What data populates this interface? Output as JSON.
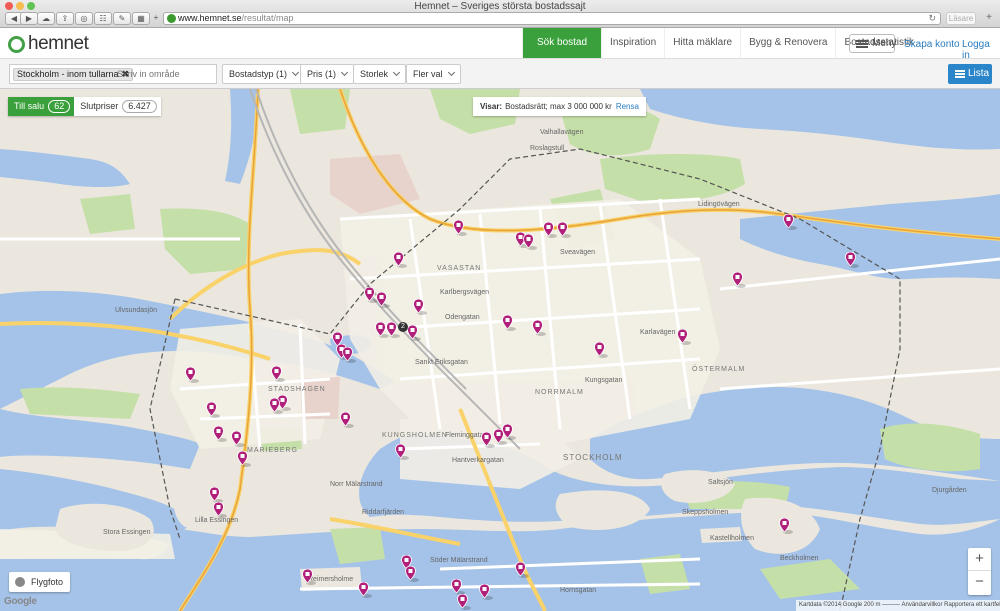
{
  "browser": {
    "window_title": "Hemnet – Sveriges största bostadssajt",
    "url_host": "www.hemnet.se",
    "url_path": "/resultat/map",
    "reader_label": "Läsare"
  },
  "header": {
    "logo_text": "hemnet",
    "nav": [
      "Sök bostad",
      "Inspiration",
      "Hitta mäklare",
      "Bygg & Renovera",
      "Bostadsstatistik"
    ],
    "menu_label": "Meny",
    "create_account": "Skapa konto",
    "login": "Logga in"
  },
  "filters": {
    "location_chip": "Stockholm - inom tullarna",
    "search_placeholder": "Skriv in område",
    "dropdowns": [
      "Bostadstyp (1)",
      "Pris (1)",
      "Storlek",
      "Fler val"
    ],
    "list_button": "Lista"
  },
  "map": {
    "tabs": [
      {
        "label": "Till salu",
        "count": "62"
      },
      {
        "label": "Slutpriser",
        "count": "6.427"
      }
    ],
    "visar_label": "Visar:",
    "visar_text": "Bostadsrätt; max 3 000 000 kr",
    "reset": "Rensa",
    "flygfoto": "Flygfoto",
    "zoom_in": "+",
    "zoom_out": "−",
    "google": "Google",
    "attribution": "Kartdata ©2014 Google   200 m ———   Användarvillkor   Rapportera ett kartfel",
    "cluster_count": "2",
    "colors": {
      "marker": "#b01f7a",
      "accent": "#3aa03c",
      "link": "#2a7dc0"
    },
    "labels": {
      "vasastan": "VASASTAN",
      "ostermalm": "ÖSTERMALM",
      "norrmalm": "NORRMALM",
      "kungsholmen": "KUNGSHOLMEN",
      "stockholm": "STOCKHOLM",
      "stadshagen": "STADSHAGEN",
      "marieberg": "MARIEBERG",
      "ulvsundasjon": "Ulvsundasjön",
      "riddarfjarden": "Riddarfjärden",
      "stora_essingen": "Stora Essingen",
      "lilla_essingen": "Lilla Essingen",
      "beckholmen": "Beckholmen",
      "skeppsholmen": "Skeppsholmen",
      "kastellholmen": "Kastellholmen",
      "djurgarden": "Djurgården",
      "saltsjon": "Saltsjön",
      "karlavagen": "Karlavägen",
      "kungsgatan": "Kungsgatan",
      "odengatan": "Odengatan",
      "karlbergsvagen": "Karlbergsvägen",
      "sveavagen": "Sveavägen",
      "valhallavagen": "Valhallavägen",
      "norr_malarstrand": "Norr Mälarstrand",
      "hantverkargatan": "Hantverkargatan",
      "fleminggatan": "Fleminggatan",
      "sankt_eriksgatan": "Sankt Eriksgatan",
      "lidingovagen": "Lidingövägen",
      "roslagstull": "Roslagstull",
      "hornsgatan": "Hornsgatan",
      "sodra_malarstrand": "Söder Mälarstrand",
      "reimersholme": "Reimersholme"
    }
  }
}
